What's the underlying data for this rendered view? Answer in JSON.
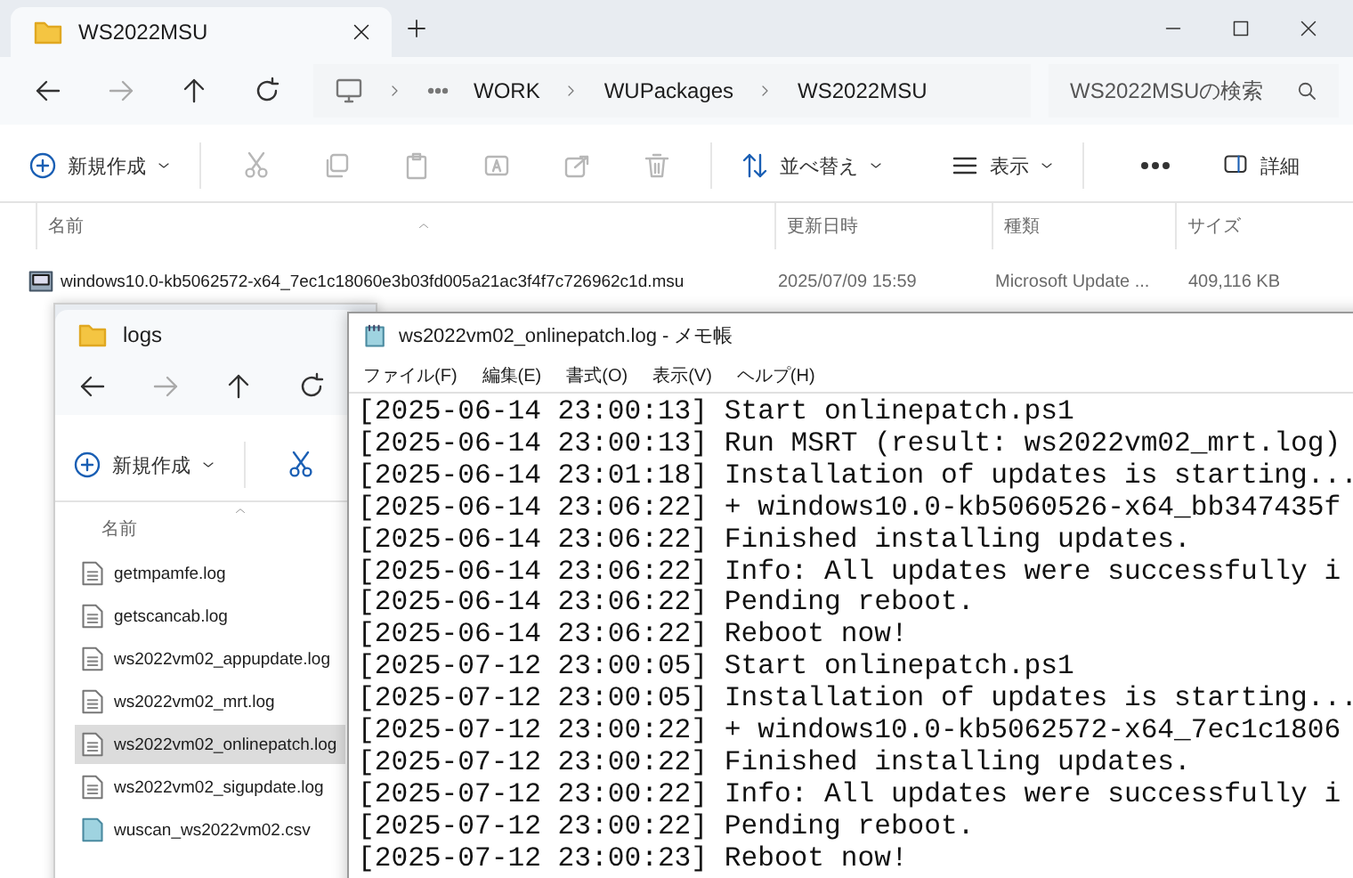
{
  "main_window": {
    "tab_title": "WS2022MSU",
    "breadcrumb": [
      "WORK",
      "WUPackages",
      "WS2022MSU"
    ],
    "search": {
      "placeholder": "WS2022MSUの検索"
    },
    "toolbar": {
      "new": "新規作成",
      "sort": "並べ替え",
      "view": "表示",
      "details": "詳細"
    },
    "columns": [
      "名前",
      "更新日時",
      "種類",
      "サイズ"
    ],
    "files": [
      {
        "name": "windows10.0-kb5062572-x64_7ec1c18060e3b03fd005a21ac3f4f7c726962c1d.msu",
        "modified": "2025/07/09 15:59",
        "type": "Microsoft Update ...",
        "size": "409,116 KB"
      }
    ]
  },
  "logs_window": {
    "tab_title": "logs",
    "toolbar": {
      "new": "新規作成"
    },
    "columns": [
      "名前"
    ],
    "files": [
      {
        "name": "getmpamfe.log",
        "kind": "log",
        "selected": false
      },
      {
        "name": "getscancab.log",
        "kind": "log",
        "selected": false
      },
      {
        "name": "ws2022vm02_appupdate.log",
        "kind": "log",
        "selected": false
      },
      {
        "name": "ws2022vm02_mrt.log",
        "kind": "log",
        "selected": false
      },
      {
        "name": "ws2022vm02_onlinepatch.log",
        "kind": "log",
        "selected": true
      },
      {
        "name": "ws2022vm02_sigupdate.log",
        "kind": "log",
        "selected": false
      },
      {
        "name": "wuscan_ws2022vm02.csv",
        "kind": "csv",
        "selected": false
      }
    ]
  },
  "notepad": {
    "title": "ws2022vm02_onlinepatch.log - メモ帳",
    "menu": [
      "ファイル(F)",
      "編集(E)",
      "書式(O)",
      "表示(V)",
      "ヘルプ(H)"
    ],
    "lines": [
      "[2025-06-14 23:00:13] Start onlinepatch.ps1",
      "[2025-06-14 23:00:13] Run MSRT (result: ws2022vm02_mrt.log)",
      "[2025-06-14 23:01:18] Installation of updates is starting...",
      "[2025-06-14 23:06:22] + windows10.0-kb5060526-x64_bb347435f",
      "[2025-06-14 23:06:22] Finished installing updates.",
      "[2025-06-14 23:06:22] Info: All updates were successfully i",
      "[2025-06-14 23:06:22] Pending reboot.",
      "[2025-06-14 23:06:22] Reboot now!",
      "[2025-07-12 23:00:05] Start onlinepatch.ps1",
      "[2025-07-12 23:00:05] Installation of updates is starting...",
      "[2025-07-12 23:00:22] + windows10.0-kb5062572-x64_7ec1c1806",
      "[2025-07-12 23:00:22] Finished installing updates.",
      "[2025-07-12 23:00:22] Info: All updates were successfully i",
      "[2025-07-12 23:00:22] Pending reboot.",
      "[2025-07-12 23:00:23] Reboot now!"
    ]
  }
}
